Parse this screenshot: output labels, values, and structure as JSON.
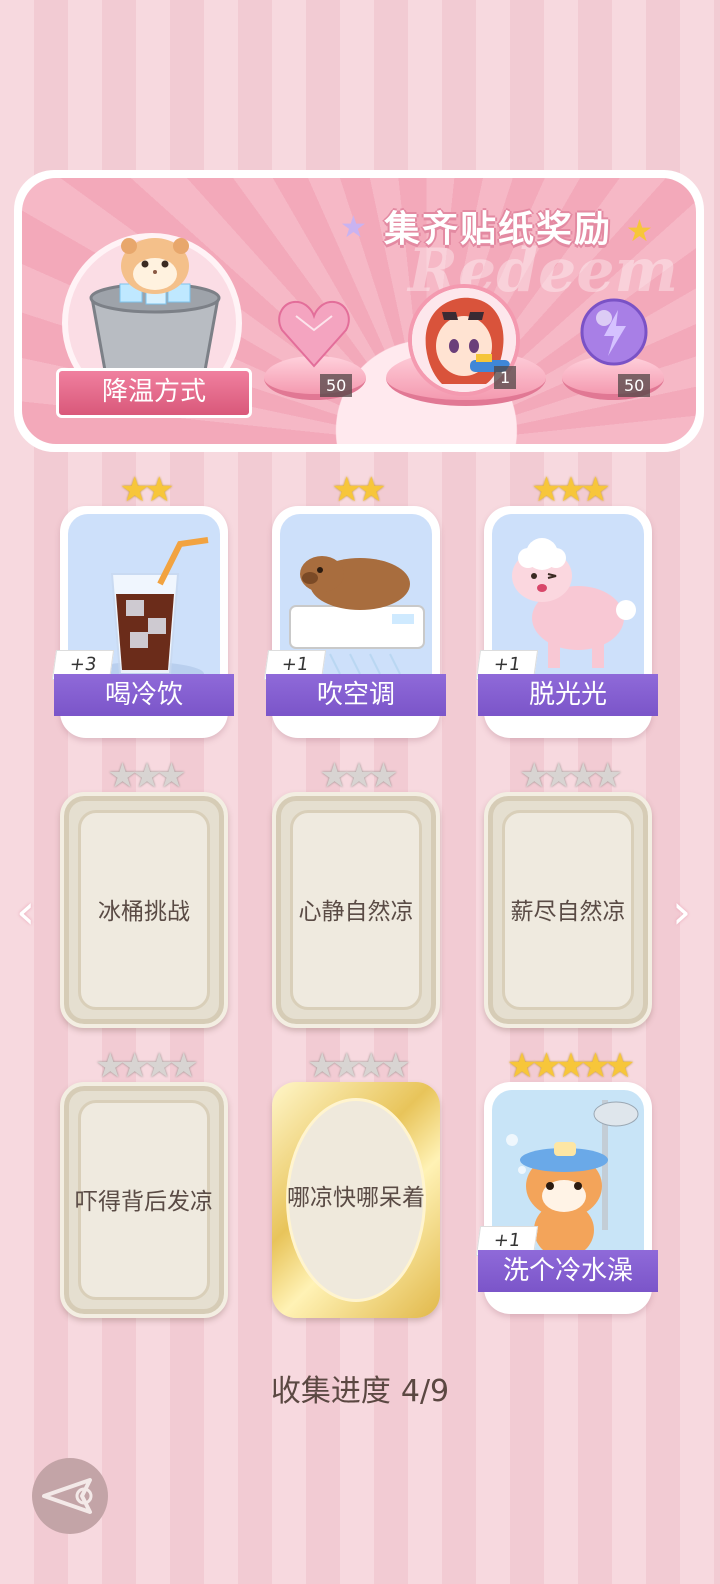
{
  "banner": {
    "title": "集齐贴纸奖励",
    "watermark": "Redeem",
    "featured_label": "降温方式",
    "rewards": [
      {
        "name": "pink-heart-gem-icon",
        "count": "50"
      },
      {
        "name": "character-avatar",
        "count": "1"
      },
      {
        "name": "purple-lightning-orb-icon",
        "count": "50"
      }
    ]
  },
  "cards": [
    {
      "label": "喝冷饮",
      "stars": 2,
      "unlocked": true,
      "plus": "+3",
      "icon": "iced-cola-icon"
    },
    {
      "label": "吹空调",
      "stars": 2,
      "unlocked": true,
      "plus": "+1",
      "icon": "capybara-air-conditioner-icon"
    },
    {
      "label": "脱光光",
      "stars": 3,
      "unlocked": true,
      "plus": "+1",
      "icon": "sheared-sheep-icon"
    },
    {
      "label": "冰桶挑战",
      "stars": 3,
      "unlocked": false
    },
    {
      "label": "心静自然凉",
      "stars": 3,
      "unlocked": false
    },
    {
      "label": "薪尽自然凉",
      "stars": 4,
      "unlocked": false
    },
    {
      "label": "吓得背后发凉",
      "stars": 4,
      "unlocked": false
    },
    {
      "label": "哪凉快哪呆着",
      "stars": 4,
      "unlocked": false
    },
    {
      "label": "洗个冷水澡",
      "stars": 5,
      "unlocked": true,
      "plus": "+1",
      "icon": "cat-shower-icon"
    }
  ],
  "progress": {
    "label": "收集进度",
    "value": "4/9"
  },
  "nav": {
    "prev": "‹",
    "next": "›"
  },
  "colors": {
    "accent_purple": "#7b55c9",
    "pink": "#f3a9ba",
    "star_gold": "#f7c63a"
  }
}
